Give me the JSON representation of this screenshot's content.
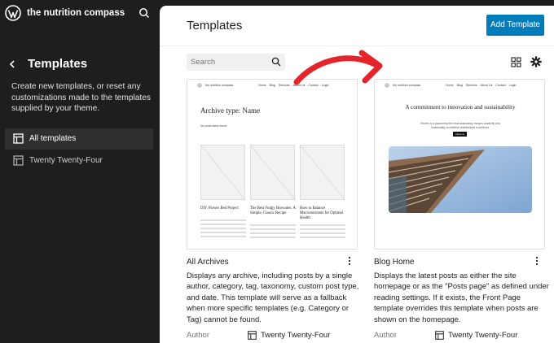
{
  "sidebar": {
    "site_name": "the nutrition compass",
    "title": "Templates",
    "description": "Create new templates, or reset any customizations made to the templates supplied by your theme.",
    "items": [
      {
        "label": "All templates"
      },
      {
        "label": "Twenty Twenty-Four"
      }
    ]
  },
  "header": {
    "title": "Templates",
    "add_button": "Add Template"
  },
  "search": {
    "placeholder": "Search"
  },
  "templates": [
    {
      "title": "All Archives",
      "description": "Displays any archive, including posts by a single author, category, tag, taxonomy, custom post type, and date. This template will serve as a fallback when more specific templates (e.g. Category or Tag) cannot be found.",
      "author_label": "Author",
      "author": "Twenty Twenty-Four",
      "preview": {
        "site": "the nutrition compass",
        "nav": [
          "Home",
          "Blog",
          "Services",
          "About Us",
          "Contact",
          "Login"
        ],
        "heading": "Archive type: Name",
        "note": "No posts were found.",
        "posts": [
          "DIY Flower Bed Project",
          "The Best Fudgy Brownies: A Simple, Classic Recipe",
          "How to Balance Macronutrients for Optimal Health"
        ]
      }
    },
    {
      "title": "Blog Home",
      "description": "Displays the latest posts as either the site homepage or as the \"Posts page\" as defined under reading settings. If it exists, the Front Page template overrides this template when posts are shown on the homepage.",
      "author_label": "Author",
      "author": "Twenty Twenty-Four",
      "preview": {
        "site": "the nutrition compass",
        "nav": [
          "Home",
          "Blog",
          "Services",
          "About Us",
          "Contact",
          "Login"
        ],
        "heading": "A commitment to innovation and sustainability",
        "sub": "Études is a pioneering firm that seamlessly merges creativity and functionality to redefine architectural excellence.",
        "button": "About us"
      }
    }
  ],
  "colors": {
    "accent": "#007cba",
    "annotation_arrow": "#e3242b"
  }
}
